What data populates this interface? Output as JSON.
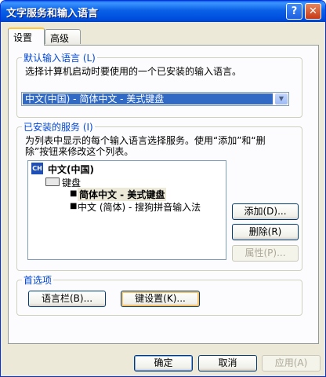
{
  "window": {
    "title": "文字服务和输入语言"
  },
  "titlebar": {
    "help_label": "?",
    "close_label": "✕"
  },
  "tabs": [
    {
      "label": "设置"
    },
    {
      "label": "高级"
    }
  ],
  "default_language": {
    "legend": "默认输入语言 (L)",
    "description": "选择计算机启动时要使用的一个已安装的输入语言。",
    "selected": "中文(中国) - 简体中文 - 美式键盘"
  },
  "installed_services": {
    "legend": "已安装的服务 (I)",
    "description_line1": "为列表中显示的每个输入语言选择服务。使用“添加”和“删",
    "description_line2": "除”按钮来修改这个列表。",
    "tree": {
      "language_code": "CH",
      "language": "中文(中国)",
      "category": "键盘",
      "items": [
        {
          "label": "简体中文 - 美式键盘",
          "selected": true
        },
        {
          "label": "中文 (简体) - 搜狗拼音输入法",
          "selected": false
        }
      ]
    },
    "buttons": {
      "add": "添加(D)...",
      "remove": "删除(R)",
      "properties": "属性(P)..."
    }
  },
  "preferences": {
    "legend": "首选项",
    "language_bar": "语言栏(B)...",
    "key_settings": "键设置(K)..."
  },
  "footer": {
    "ok": "确定",
    "cancel": "取消",
    "apply": "应用(A)"
  }
}
